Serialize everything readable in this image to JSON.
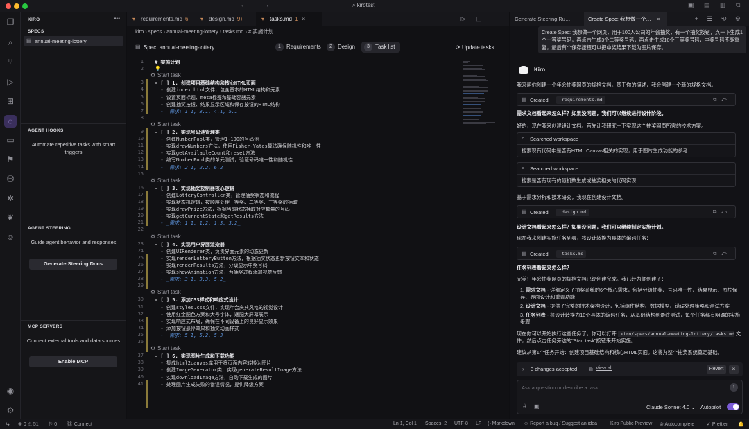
{
  "window": {
    "title": "kirotest",
    "nav_arrows": "← →",
    "right_icons": "▣ ▤ ▥ ⧉"
  },
  "activity_icons": [
    "files-icon",
    "search-icon",
    "source-control-icon",
    "run-debug-icon",
    "extensions-icon",
    "kiro-ghost-icon",
    "folder-icon",
    "bookmark-icon",
    "database-icon",
    "gear-bug-icon",
    "leaf-icon",
    "robot-icon"
  ],
  "sidebar": {
    "title": "KIRO",
    "more": "•••",
    "specs_heading": "SPECS",
    "spec_item": "annual-meeting-lottery",
    "hooks_heading": "AGENT HOOKS",
    "hooks_desc": "Automate repetitive tasks with smart triggers",
    "steering_heading": "AGENT STEERING",
    "steering_desc": "Guide agent behavior and responses",
    "steering_button": "Generate Steering Docs",
    "mcp_heading": "MCP SERVERS",
    "mcp_desc": "Connect external tools and data sources",
    "mcp_button": "Enable MCP"
  },
  "editor": {
    "tabs": [
      {
        "label": "requirements.md",
        "badge": "6"
      },
      {
        "label": "design.md",
        "badge": "9+"
      },
      {
        "label": "tasks.md",
        "badge": "1"
      }
    ],
    "tab_close": "×",
    "toolbar_icons": "▷ ◫ ⋯",
    "breadcrumb": ".kiro › specs › annual-meeting-lottery › tasks.md › # 实施计划",
    "spec_title": "Spec: annual-meeting-lottery",
    "steps": [
      {
        "num": "1",
        "label": "Requirements"
      },
      {
        "num": "2",
        "label": "Design"
      },
      {
        "num": "3",
        "label": "Task list"
      }
    ],
    "update_tasks": "Update tasks",
    "start_task": "Start task",
    "lines": [
      {
        "n": "1",
        "t": "# 实施计划",
        "k": "head"
      },
      {
        "n": "2",
        "t": "💡",
        "k": ""
      },
      {
        "n": "",
        "t": "Start task",
        "k": "start"
      },
      {
        "n": "3",
        "t": "- [ ] 1. 创建项目基础结构和核心HTML页面",
        "k": "head"
      },
      {
        "n": "4",
        "t": "  - 创建index.html文件，包含基本的HTML结构和元素",
        "k": ""
      },
      {
        "n": "5",
        "t": "  - 设置页面标题、meta标签和基础容器元素",
        "k": ""
      },
      {
        "n": "6",
        "t": "  - 创建抽奖按钮、结果显示区域和保存按钮的HTML结构",
        "k": ""
      },
      {
        "n": "7",
        "t": "  - _需求: 1.1, 3.1, 4.1, 5.1_",
        "k": "req"
      },
      {
        "n": "8",
        "t": "",
        "k": ""
      },
      {
        "n": "",
        "t": "Start task",
        "k": "start"
      },
      {
        "n": "9",
        "t": "- [ ] 2. 实现号码池管理类",
        "k": "head"
      },
      {
        "n": "10",
        "t": "  - 创建NumberPool类，管理1-100的号码池",
        "k": ""
      },
      {
        "n": "11",
        "t": "  - 实现drawNumbers方法，使用Fisher-Yates算法确保随机性和唯一性",
        "k": ""
      },
      {
        "n": "12",
        "t": "  - 实现getAvailableCount和reset方法",
        "k": ""
      },
      {
        "n": "13",
        "t": "  - 编写NumberPool类的单元测试，验证号码唯一性和随机性",
        "k": ""
      },
      {
        "n": "14",
        "t": "  - _需求: 2.1, 2.2, 6.2_",
        "k": "req"
      },
      {
        "n": "15",
        "t": "",
        "k": ""
      },
      {
        "n": "",
        "t": "Start task",
        "k": "start"
      },
      {
        "n": "16",
        "t": "- [ ] 3. 实现抽奖控制器核心逻辑",
        "k": "head"
      },
      {
        "n": "17",
        "t": "  - 创建LotteryController类，管理抽奖状态和流程",
        "k": ""
      },
      {
        "n": "18",
        "t": "  - 实现状态机逻辑，按顺序处理一等奖、二等奖、三等奖的抽取",
        "k": ""
      },
      {
        "n": "19",
        "t": "  - 实现drawPrize方法，根据当前状态抽取对应数量的号码",
        "k": ""
      },
      {
        "n": "20",
        "t": "  - 实现getCurrentState和getResults方法",
        "k": ""
      },
      {
        "n": "21",
        "t": "  - _需求: 1.1, 1.2, 1.3, 3.2_",
        "k": "req"
      },
      {
        "n": "22",
        "t": "",
        "k": ""
      },
      {
        "n": "",
        "t": "Start task",
        "k": "start"
      },
      {
        "n": "23",
        "t": "- [ ] 4. 实现用户界面渲染器",
        "k": "head"
      },
      {
        "n": "24",
        "t": "  - 创建UIRenderer类，负责界面元素的动态更新",
        "k": ""
      },
      {
        "n": "25",
        "t": "  - 实现renderLotteryButton方法，根据抽奖状态更新按钮文本和状态",
        "k": ""
      },
      {
        "n": "26",
        "t": "  - 实现renderResults方法，分级显示中奖号码",
        "k": ""
      },
      {
        "n": "27",
        "t": "  - 实现showAnimation方法，为抽奖过程添加视觉反馈",
        "k": ""
      },
      {
        "n": "28",
        "t": "  - _需求: 3.1, 3.3, 5.2_",
        "k": "req"
      },
      {
        "n": "29",
        "t": "",
        "k": ""
      },
      {
        "n": "",
        "t": "Start task",
        "k": "start"
      },
      {
        "n": "30",
        "t": "- [ ] 5. 添加CSS样式和响应式设计",
        "k": "head"
      },
      {
        "n": "31",
        "t": "  - 创建styles.css文件，实现年会庆典风格的视觉设计",
        "k": ""
      },
      {
        "n": "32",
        "t": "  - 使用红金配色方案和大号字体，适配大屏幕展示",
        "k": ""
      },
      {
        "n": "33",
        "t": "  - 实现响应式布局，确保在不同设备上的良好显示效果",
        "k": ""
      },
      {
        "n": "34",
        "t": "  - 添加按钮悬停效果和抽奖动画样式",
        "k": ""
      },
      {
        "n": "35",
        "t": "  - _需求: 5.1, 5.2, 5.3_",
        "k": "req"
      },
      {
        "n": "36",
        "t": "",
        "k": ""
      },
      {
        "n": "",
        "t": "Start task",
        "k": "start"
      },
      {
        "n": "37",
        "t": "- [ ] 6. 实现图片生成和下载功能",
        "k": "head"
      },
      {
        "n": "38",
        "t": "  - 集成html2canvas库用于将页面内容转换为图片",
        "k": ""
      },
      {
        "n": "39",
        "t": "  - 创建ImageGenerator类，实现generateResultImage方法",
        "k": ""
      },
      {
        "n": "40",
        "t": "  - 实现downloadImage方法，自动下载生成的图片",
        "k": ""
      },
      {
        "n": "41",
        "t": "  - 处理图片生成失败的错误情况，提供降级方案",
        "k": ""
      }
    ]
  },
  "chat": {
    "tabs": [
      "Generate Steering Ru…",
      "Create Spec: 我想做一个…"
    ],
    "tab_close": "×",
    "tab_icons": "+ ☰ ⟲ ⚙",
    "user_message": "Create Spec: 我想做一个网页，用于100人公司的年会抽奖，有一个抽奖按钮，点一下生成1个一等奖号码，再点击生成3个二等奖号码，再点击生成10个三等奖号码，中奖号码不能重复，最后有个保存按钮可以把中奖结果下载为图片保存。",
    "assistant_name": "Kiro",
    "p1": "我来帮你创建一个年会抽奖网页的规格文档。基于你的描述，我会创建一个新的规格文档。",
    "created_label": "Created",
    "file1": "requirements.md",
    "q1": "需求文档看起来怎么样？如果没问题，我们可以继续进行设计阶段。",
    "p2": "好的，现在我来创建设计文档。首先让我研究一下实现这个抽奖网页所需的技术方案。",
    "searched_label": "Searched workspace",
    "search1": "搜索现有代码中是否有HTML Canvas相关的实现，用于图片生成功能的参考",
    "search2": "搜索是否有现有的随机数生成或抽奖相关的代码实现",
    "p3": "基于需求分析和技术研究，我现在创建设计文档。",
    "file2": "design.md",
    "q2": "设计文档看起来怎么样？如果没问题，我们可以继续制定实施计划。",
    "p4": "现在我来创建实施任务列表，将设计转换为具体的编码任务：",
    "file3": "tasks.md",
    "q3": "任务列表看起来怎么样？",
    "p5": "完美！年会抽奖网页的规格文档已经创建完成。我已经为你创建了：",
    "list": [
      {
        "n": "1.",
        "b": "需求文档",
        "t": " - 详细定义了抽奖系统的6个核心需求，包括分级抽奖、号码唯一性、结果显示、图片保存、界面设计和重置功能"
      },
      {
        "n": "2.",
        "b": "设计文档",
        "t": " - 提供了完整的技术架构设计，包括组件结构、数据模型、错误处理策略和测试方案"
      },
      {
        "n": "3.",
        "b": "任务列表",
        "t": " - 将设计转换为10个具体的编码任务，从基础结构到最终测试，每个任务都有明确的实施步骤"
      }
    ],
    "p6a": "现在你可以开始执行这些任务了。你可以打开",
    "p6path": ".kiro/specs/annual-meeting-lottery/tasks.md",
    "p6b": "文件，然后点击任务旁边的\"Start task\"按钮来开始实施。",
    "p7": "建议从第1个任务开始：创建项目基础结构和核心HTML页面。这将为整个抽奖系统奠定基础。",
    "changes": "3 changes accepted",
    "view_all": "View all",
    "revert": "Revert",
    "input_placeholder": "Ask a question or describe a task...",
    "model": "Claude Sonnet 4.0",
    "autopilot": "Autopilot"
  },
  "status": {
    "errors": "0",
    "warnings": "51",
    "ports": "0",
    "connect": "Connect",
    "position": "Ln 1, Col 1",
    "spaces": "Spaces: 2",
    "encoding": "UTF-8",
    "eol": "LF",
    "language": "Markdown",
    "report": "Report a bug / Suggest an idea",
    "preview": "Kiro Public Preview",
    "autocomplete": "Autocomplete",
    "prettier": "Prettier"
  },
  "colors": {
    "accent": "#7b5cd6",
    "autopilot_on": "#7b5cd6"
  }
}
